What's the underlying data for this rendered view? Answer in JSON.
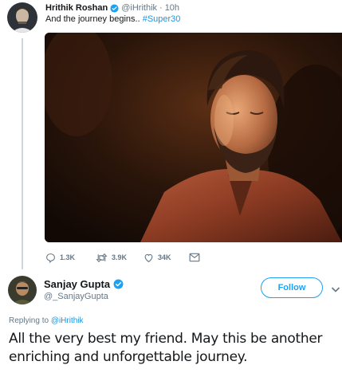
{
  "parent_tweet": {
    "author_name": "Hrithik Roshan",
    "author_handle": "@iHrithik",
    "separator": "·",
    "timestamp": "10h",
    "text": "And the journey begins.. ",
    "hashtag": "#Super30",
    "media_icon": "photo-of-man-in-warm-light",
    "actions": {
      "reply_count": "1.3K",
      "retweet_count": "3.9K",
      "like_count": "34K"
    }
  },
  "reply_tweet": {
    "author_name": "Sanjay Gupta",
    "author_handle": "@_SanjayGupta",
    "follow_label": "Follow",
    "replying_to_prefix": "Replying to ",
    "replying_to_handle": "@iHrithik",
    "text": "All the very best my friend. May this be another enriching and unforgettable journey."
  },
  "colors": {
    "link": "#1b95e0",
    "brand": "#1da1f2",
    "secondary_text": "#657786",
    "thread_line": "#ccd6dd"
  }
}
